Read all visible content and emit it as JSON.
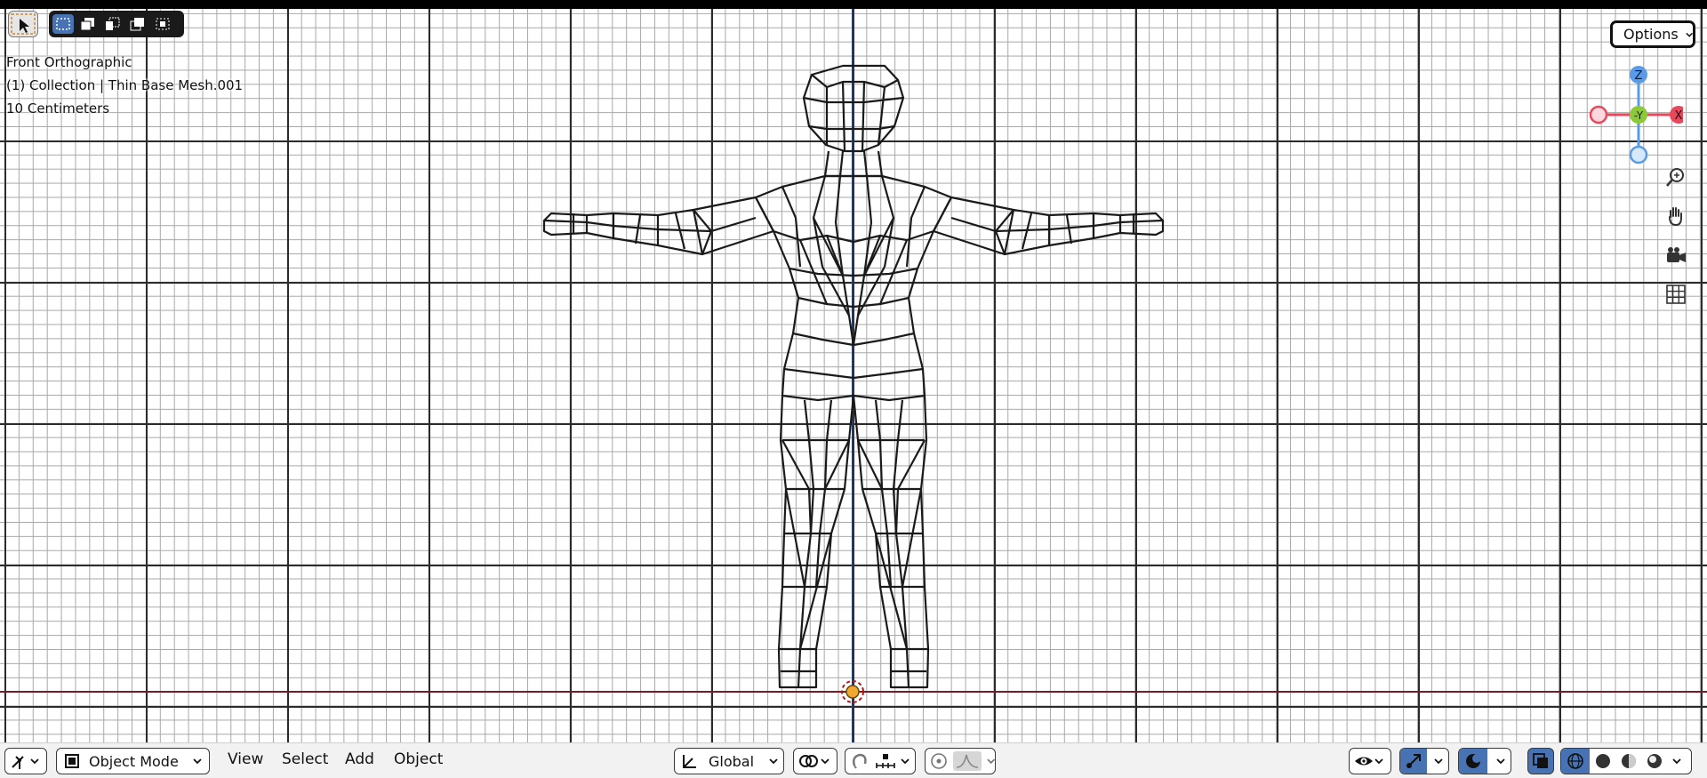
{
  "viewport": {
    "view_name": "Front Orthographic",
    "collection_info": "(1) Collection | Thin Base Mesh.001",
    "grid_scale": "10 Centimeters"
  },
  "toolbar": {
    "options_label": "Options"
  },
  "gizmo": {
    "z_label": "Z",
    "y_label": "-Y",
    "x_label": "X"
  },
  "header": {
    "mode_label": "Object Mode",
    "menu_view": "View",
    "menu_select": "Select",
    "menu_add": "Add",
    "menu_object": "Object",
    "transform_orientation": "Global"
  },
  "colors": {
    "axis_x": "#7a1b24",
    "axis_z": "#1f3b6e",
    "active_blue": "#4772b3",
    "gizmo_x": "#e8485c",
    "gizmo_y": "#8bc83a",
    "gizmo_z": "#5a9be8",
    "origin": "#f0a830"
  },
  "icons": [
    "cursor-icon",
    "select-box-icon",
    "select-extend-icon",
    "select-subtract-icon",
    "select-difference-icon",
    "select-intersect-icon",
    "zoom-icon",
    "hand-pan-icon",
    "camera-icon",
    "grid-icon",
    "transform-icon",
    "snap-icon",
    "proportional-icon",
    "overlay-eye-icon",
    "gizmo-icon",
    "overlays-icon",
    "xray-icon",
    "wireframe-shading-icon",
    "solid-shading-icon",
    "material-shading-icon",
    "rendered-shading-icon"
  ]
}
